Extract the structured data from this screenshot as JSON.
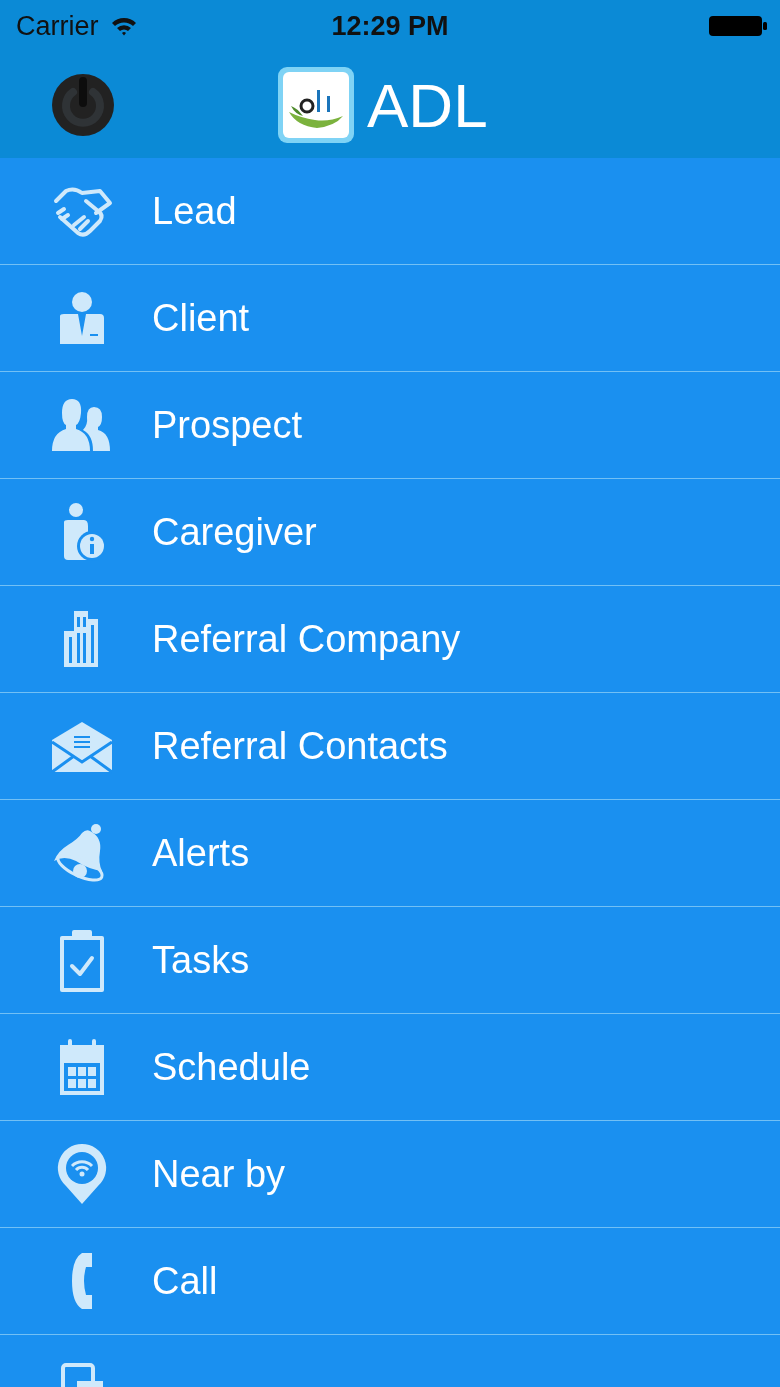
{
  "status_bar": {
    "carrier": "Carrier",
    "time": "12:29 PM"
  },
  "header": {
    "title": "ADL"
  },
  "menu": [
    {
      "label": "Lead"
    },
    {
      "label": "Client"
    },
    {
      "label": "Prospect"
    },
    {
      "label": "Caregiver"
    },
    {
      "label": "Referral Company"
    },
    {
      "label": "Referral Contacts"
    },
    {
      "label": "Alerts"
    },
    {
      "label": "Tasks"
    },
    {
      "label": "Schedule"
    },
    {
      "label": "Near by"
    },
    {
      "label": "Call"
    }
  ]
}
